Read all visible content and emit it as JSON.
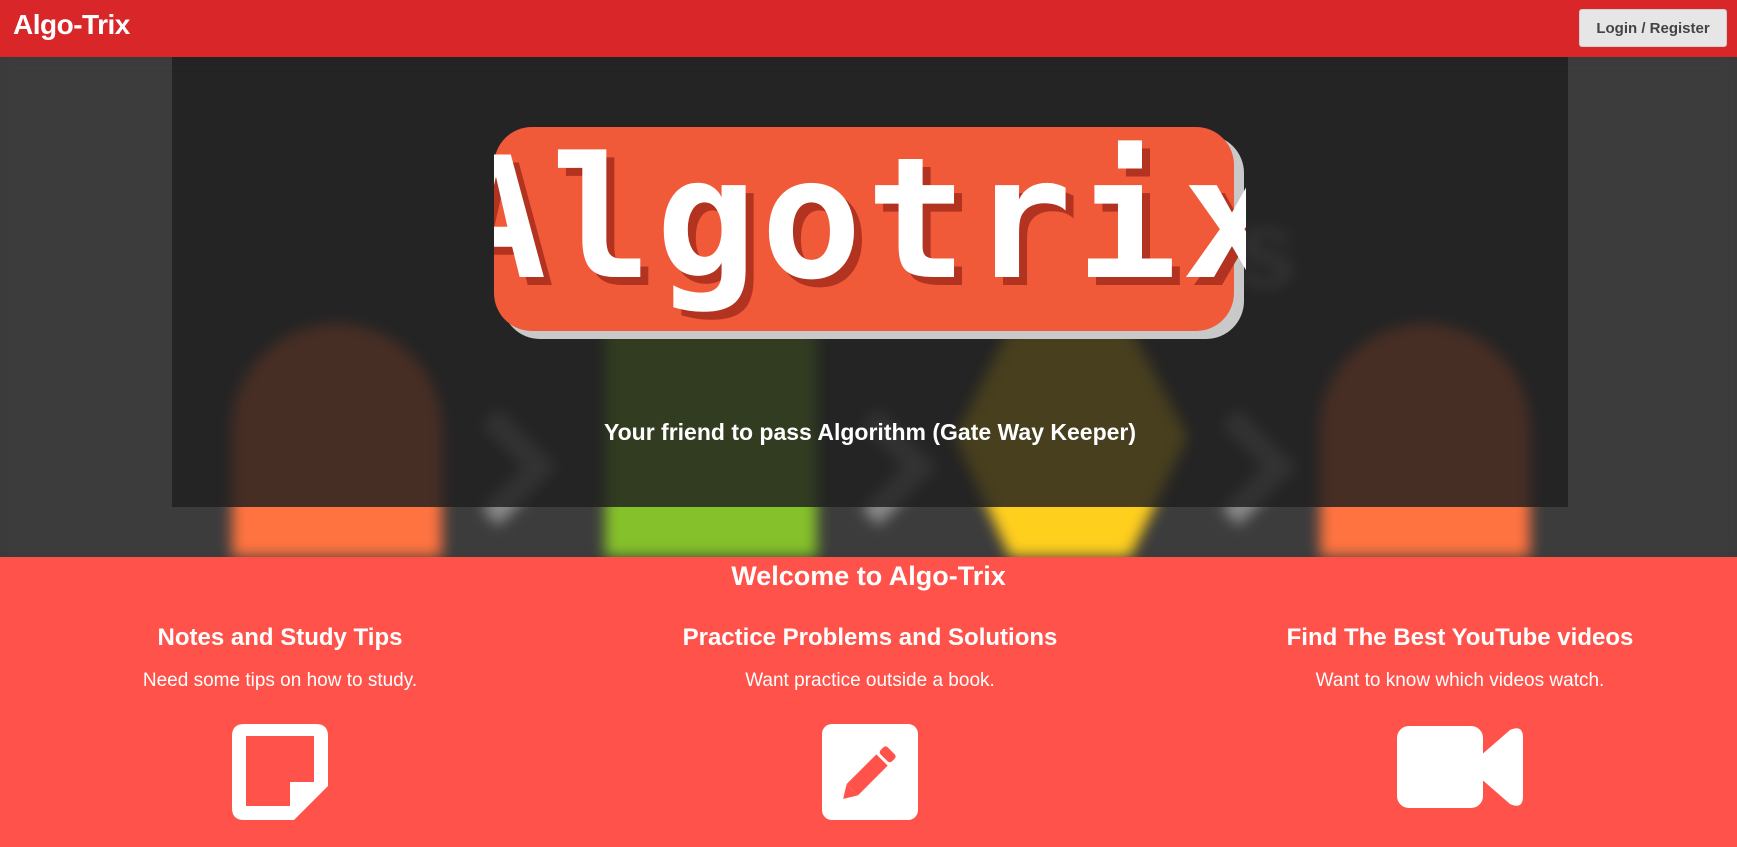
{
  "navbar": {
    "brand": "Algo-Trix",
    "login_label": "Login / Register"
  },
  "hero": {
    "logo_text": "Algotrix",
    "tagline": "Your friend to pass Algorithm (Gate Way Keeper)"
  },
  "welcome": {
    "title": "Welcome to Algo-Trix"
  },
  "features": [
    {
      "title": "Notes and Study Tips",
      "text": "Need some tips on how to study.",
      "icon": "sticky-note-icon"
    },
    {
      "title": "Practice Problems and Solutions",
      "text": "Want practice outside a book.",
      "icon": "pencil-square-icon"
    },
    {
      "title": "Find The Best YouTube videos",
      "text": "Want to know which videos watch.",
      "icon": "video-camera-icon"
    }
  ],
  "colors": {
    "navbar": "#d92629",
    "page_background": "#ff524a",
    "logo_badge": "#f05a38",
    "hero_overlay": "#1e1e1e"
  }
}
